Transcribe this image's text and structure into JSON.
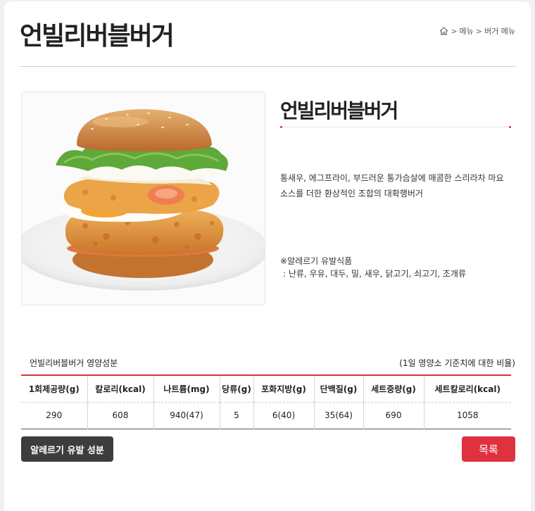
{
  "header": {
    "title": "언빌리버블버거",
    "breadcrumb": {
      "sep1": ">",
      "menu": "메뉴",
      "sep2": ">",
      "current": "버거 메뉴"
    }
  },
  "product": {
    "name": "언빌리버블버거",
    "description": "통새우, 에그프라이, 부드러운 통가슴살에 매콤한 스리라차 마요 소스를 더한 환상적인 조합의 대확행버거",
    "allergy_title": "※알레르기 유발식품",
    "allergy_list": ": 난류, 우유, 대두, 밀, 새우, 닭고기, 쇠고기, 조개류"
  },
  "nutrition": {
    "title": "언빌리버블버거 영양성분",
    "note": "(1일 영양소 기준치에 대한 비율)",
    "headers": [
      "1회제공량(g)",
      "칼로리(kcal)",
      "나트륨(mg)",
      "당류(g)",
      "포화지방(g)",
      "단백질(g)",
      "세트중량(g)",
      "세트칼로리(kcal)"
    ],
    "values": [
      "290",
      "608",
      "940(47)",
      "5",
      "6(40)",
      "35(64)",
      "690",
      "1058"
    ]
  },
  "buttons": {
    "allergy": "알레르기 유발 성분",
    "list": "목록"
  },
  "colors": {
    "accent": "#e0313f",
    "dark_button": "#3d3d3d"
  }
}
